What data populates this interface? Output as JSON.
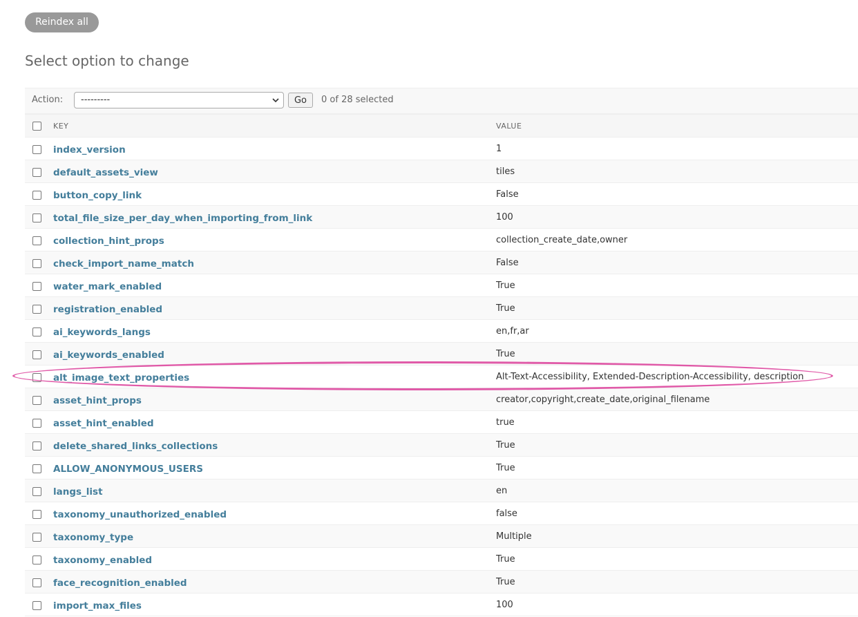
{
  "toolbar": {
    "reindex_label": "Reindex all"
  },
  "page_title": "Select option to change",
  "actions": {
    "label": "Action:",
    "selected_value": "---------",
    "go_label": "Go",
    "selected_count": "0 of 28 selected"
  },
  "table": {
    "headers": {
      "key": "KEY",
      "value": "VALUE"
    },
    "rows": [
      {
        "key": "index_version",
        "value": "1"
      },
      {
        "key": "default_assets_view",
        "value": "tiles"
      },
      {
        "key": "button_copy_link",
        "value": "False"
      },
      {
        "key": "total_file_size_per_day_when_importing_from_link",
        "value": "100"
      },
      {
        "key": "collection_hint_props",
        "value": "collection_create_date,owner"
      },
      {
        "key": "check_import_name_match",
        "value": "False"
      },
      {
        "key": "water_mark_enabled",
        "value": "True"
      },
      {
        "key": "registration_enabled",
        "value": "True"
      },
      {
        "key": "ai_keywords_langs",
        "value": "en,fr,ar"
      },
      {
        "key": "ai_keywords_enabled",
        "value": "True"
      },
      {
        "key": "alt_image_text_properties",
        "value": "Alt-Text-Accessibility, Extended-Description-Accessibility, description"
      },
      {
        "key": "asset_hint_props",
        "value": "creator,copyright,create_date,original_filename"
      },
      {
        "key": "asset_hint_enabled",
        "value": "true"
      },
      {
        "key": "delete_shared_links_collections",
        "value": "True"
      },
      {
        "key": "ALLOW_ANONYMOUS_USERS",
        "value": "True"
      },
      {
        "key": "langs_list",
        "value": "en"
      },
      {
        "key": "taxonomy_unauthorized_enabled",
        "value": "false"
      },
      {
        "key": "taxonomy_type",
        "value": "Multiple"
      },
      {
        "key": "taxonomy_enabled",
        "value": "True"
      },
      {
        "key": "face_recognition_enabled",
        "value": "True"
      },
      {
        "key": "import_max_files",
        "value": "100"
      }
    ]
  },
  "colors": {
    "link": "#447e9b",
    "highlight": "#e05aa8",
    "button_gray": "#999999"
  }
}
